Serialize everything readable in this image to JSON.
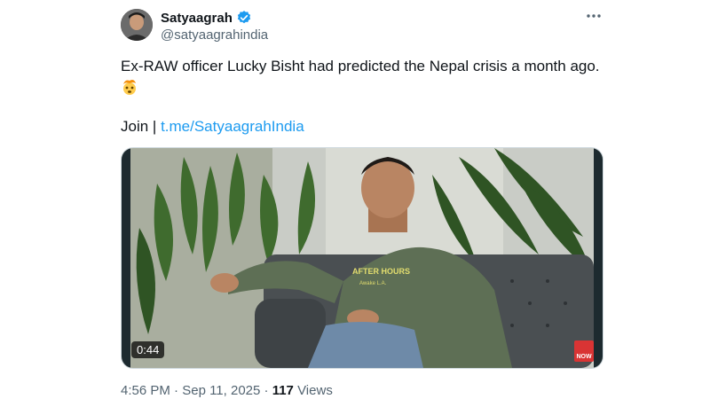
{
  "author": {
    "display_name": "Satyaagrah",
    "handle": "@satyaagrahindia",
    "verified": true
  },
  "tweet": {
    "text": "Ex-RAW officer Lucky Bisht had predicted the Nepal crisis a month ago.",
    "emoji": "exploding-head",
    "join_prefix": "Join | ",
    "join_link": "t.me/SatyaagrahIndia"
  },
  "media": {
    "duration": "0:44",
    "channel_logo_text": "NOW",
    "hoodie_text_line1": "AFTER HOURS",
    "hoodie_text_line2": "Awake L.A."
  },
  "meta": {
    "time": "4:56 PM",
    "separator": " · ",
    "date": "Sep 11, 2025",
    "views_count": "117",
    "views_label": " Views"
  },
  "colors": {
    "link": "#1d9bf0",
    "verified": "#1d9bf0",
    "secondary_text": "#536471"
  }
}
